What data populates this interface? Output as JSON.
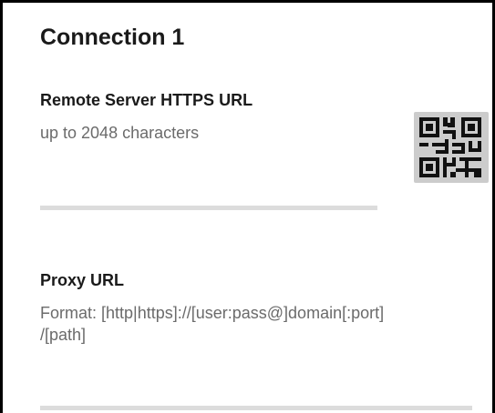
{
  "section": {
    "title": "Connection 1"
  },
  "remote_server": {
    "label": "Remote Server HTTPS URL",
    "placeholder": "up to 2048 characters",
    "value": ""
  },
  "qr_button": {
    "icon": "qr-code-icon"
  },
  "proxy": {
    "label": "Proxy URL",
    "placeholder_line1": "Format: [http|https]://[user:pass@]domain[:port]",
    "placeholder_line2": "/[path]",
    "value": ""
  }
}
